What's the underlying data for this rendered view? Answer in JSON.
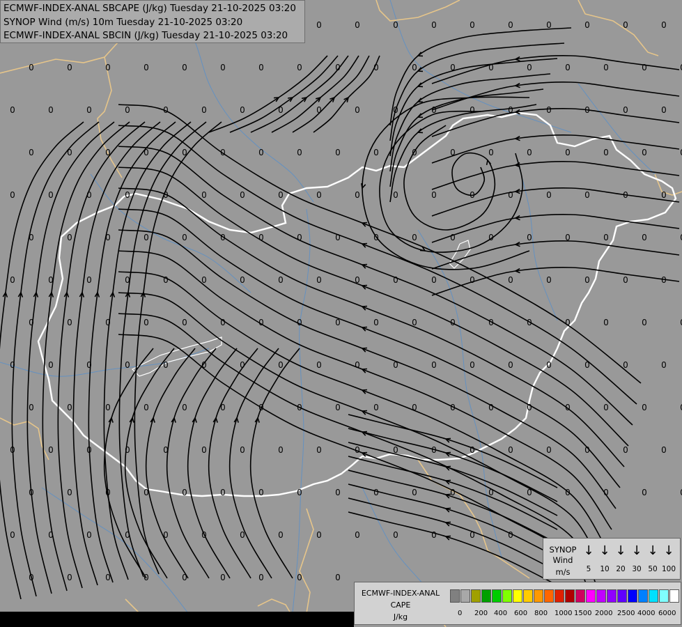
{
  "titles": {
    "line1": "ECMWF-INDEX-ANAL SBCAPE (J/kg) Tuesday 21-10-2025 03:20",
    "line2": "SYNOP Wind (m/s) 10m Tuesday 21-10-2025 03:20",
    "line3": "ECMWF-INDEX-ANAL SBCIN (J/kg) Tuesday 21-10-2025 03:20"
  },
  "value_label": "0",
  "wind_legend": {
    "label_1": "SYNOP",
    "label_2": "Wind",
    "label_3": "m/s",
    "arrow_glyph": "↓",
    "values": [
      "5",
      "10",
      "20",
      "30",
      "50",
      "100"
    ]
  },
  "cape_legend": {
    "label_1": "ECMWF-INDEX-ANAL",
    "label_2": "CAPE",
    "label_3": "J/kg",
    "colors": [
      "#808080",
      "#a8a8a8",
      "#a0a000",
      "#00a000",
      "#00cc00",
      "#80ff00",
      "#ffff00",
      "#ffcc00",
      "#ff9900",
      "#ff6600",
      "#e02000",
      "#b00000",
      "#d00060",
      "#ff00ff",
      "#c000ff",
      "#9000ff",
      "#6000ff",
      "#0000ff",
      "#0080ff",
      "#00e0ff",
      "#80ffff",
      "#ffffff"
    ],
    "ticks": [
      "0",
      "200",
      "400",
      "600",
      "800",
      "1000",
      "1500",
      "2000",
      "2500",
      "4000",
      "6000"
    ]
  },
  "map_colors": {
    "background": "#999999",
    "border": "#ffffff",
    "foreign_border": "#e6c58a",
    "river": "#5a8fc8",
    "streamline": "#000000"
  }
}
